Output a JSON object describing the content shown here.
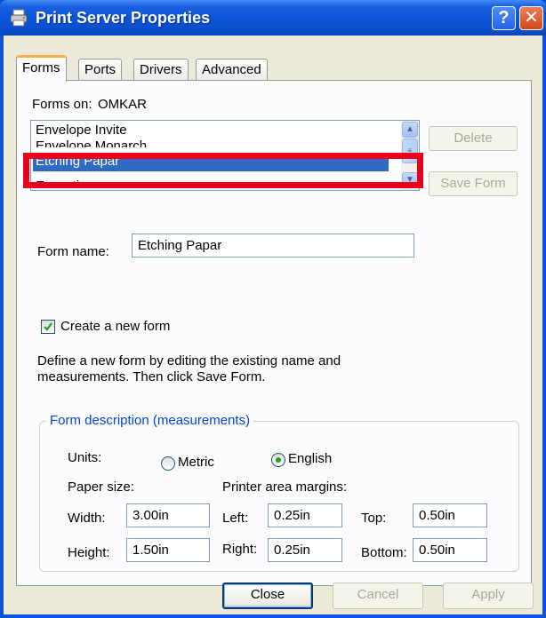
{
  "window": {
    "title": "Print Server Properties",
    "help_glyph": "?",
    "close_glyph": "✕"
  },
  "tabs": [
    {
      "label": "Forms",
      "active": true
    },
    {
      "label": "Ports",
      "active": false
    },
    {
      "label": "Drivers",
      "active": false
    },
    {
      "label": "Advanced",
      "active": false
    }
  ],
  "forms": {
    "forms_on_label": "Forms on:",
    "server_name": "OMKAR",
    "list": [
      "Envelope Invite",
      "Envelope Monarch",
      "Etching Papar",
      "Executive"
    ],
    "selected": "Etching Papar",
    "delete_label": "Delete",
    "save_form_label": "Save Form",
    "form_name_label": "Form name:",
    "form_name_value": "Etching Papar",
    "create_new_label": "Create a new form",
    "create_new_checked": true,
    "hint_line1": "Define a new form by editing the existing name and",
    "hint_line2": "measurements.  Then click Save Form."
  },
  "description": {
    "caption": "Form description (measurements)",
    "units_label": "Units:",
    "metric_label": "Metric",
    "english_label": "English",
    "selected_unit": "English",
    "paper_size_label": "Paper size:",
    "margins_label": "Printer area margins:",
    "width_label": "Width:",
    "width_value": "3.00in",
    "height_label": "Height:",
    "height_value": "1.50in",
    "left_label": "Left:",
    "left_value": "0.25in",
    "right_label": "Right:",
    "right_value": "0.25in",
    "top_label": "Top:",
    "top_value": "0.50in",
    "bottom_label": "Bottom:",
    "bottom_value": "0.50in"
  },
  "footer": {
    "close_label": "Close",
    "cancel_label": "Cancel",
    "apply_label": "Apply"
  },
  "colors": {
    "titlebar": "#0a52d8",
    "selection": "#316ac5",
    "highlight_box": "#e8001c",
    "group_caption": "#0046d5"
  }
}
